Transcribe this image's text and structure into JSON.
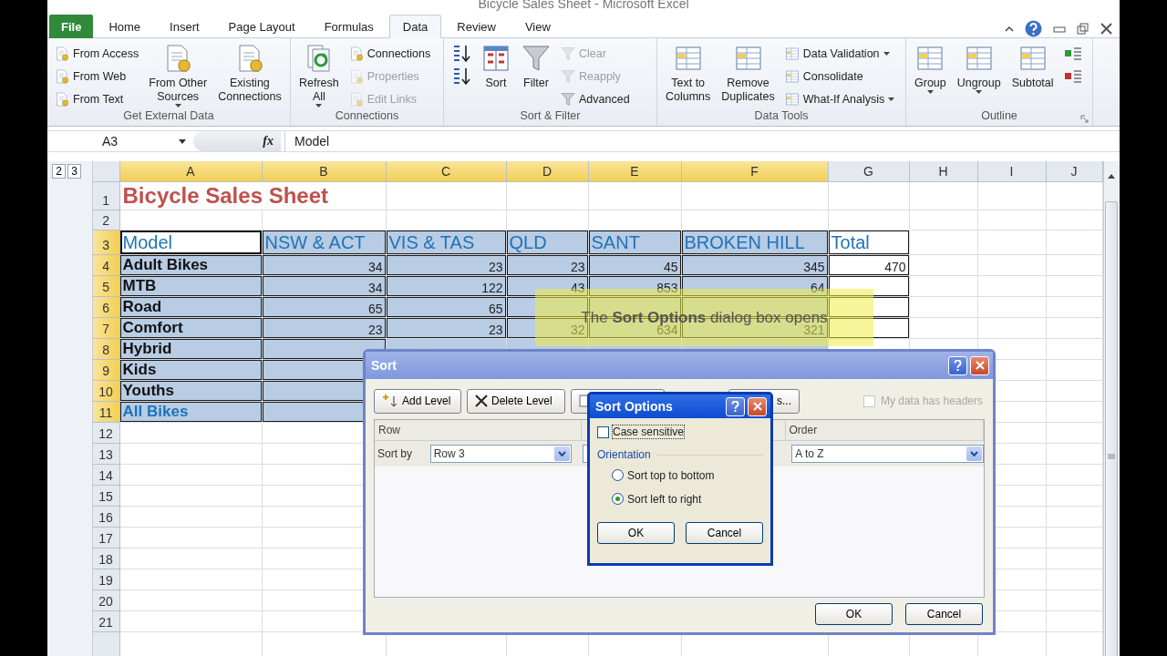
{
  "window": {
    "title": "Bicycle Sales Sheet - Microsoft Excel"
  },
  "ribbon": {
    "tabs": [
      {
        "label": "File",
        "kind": "file",
        "selected": false
      },
      {
        "label": "Home",
        "kind": "tab",
        "selected": false
      },
      {
        "label": "Insert",
        "kind": "tab",
        "selected": false
      },
      {
        "label": "Page Layout",
        "kind": "tab",
        "selected": false
      },
      {
        "label": "Formulas",
        "kind": "tab",
        "selected": false
      },
      {
        "label": "Data",
        "kind": "tab",
        "selected": true
      },
      {
        "label": "Review",
        "kind": "tab",
        "selected": false
      },
      {
        "label": "View",
        "kind": "tab",
        "selected": false
      }
    ],
    "groups": [
      {
        "title": "Get External Data",
        "launcher": false,
        "columns": [
          {
            "kind": "stack",
            "items": [
              {
                "label": "From Access",
                "disabled": false,
                "dropdown": false
              },
              {
                "label": "From Web",
                "disabled": false,
                "dropdown": false
              },
              {
                "label": "From Text",
                "disabled": false,
                "dropdown": false
              }
            ]
          },
          {
            "kind": "large",
            "label": "From Other\nSources",
            "disabled": false,
            "dropdown": true
          },
          {
            "kind": "large",
            "label": "Existing\nConnections",
            "disabled": false,
            "dropdown": false
          }
        ]
      },
      {
        "title": "Connections",
        "launcher": false,
        "columns": [
          {
            "kind": "large",
            "label": "Refresh\nAll",
            "disabled": false,
            "dropdown": true
          },
          {
            "kind": "stack",
            "items": [
              {
                "label": "Connections",
                "disabled": false,
                "dropdown": false
              },
              {
                "label": "Properties",
                "disabled": true,
                "dropdown": false
              },
              {
                "label": "Edit Links",
                "disabled": true,
                "dropdown": false
              }
            ]
          }
        ]
      },
      {
        "title": "Sort & Filter",
        "launcher": false,
        "columns": [
          {
            "kind": "stack",
            "items": [
              {
                "disabled": false,
                "dropdown": false
              },
              {
                "disabled": false,
                "dropdown": false
              }
            ]
          },
          {
            "kind": "large",
            "label": "Sort",
            "disabled": false,
            "dropdown": false
          },
          {
            "kind": "large",
            "label": "Filter",
            "disabled": false,
            "dropdown": false
          },
          {
            "kind": "stack",
            "items": [
              {
                "label": "Clear",
                "disabled": true,
                "dropdown": false
              },
              {
                "label": "Reapply",
                "disabled": true,
                "dropdown": false
              },
              {
                "label": "Advanced",
                "disabled": false,
                "dropdown": false
              }
            ]
          }
        ]
      },
      {
        "title": "Data Tools",
        "launcher": false,
        "columns": [
          {
            "kind": "large",
            "label": "Text to\nColumns",
            "disabled": false,
            "dropdown": false
          },
          {
            "kind": "large",
            "label": "Remove\nDuplicates",
            "disabled": false,
            "dropdown": false
          },
          {
            "kind": "stack",
            "items": [
              {
                "label": "Data Validation",
                "disabled": false,
                "dropdown": true
              },
              {
                "label": "Consolidate",
                "disabled": false,
                "dropdown": false
              },
              {
                "label": "What-If Analysis",
                "disabled": false,
                "dropdown": true
              }
            ]
          }
        ]
      },
      {
        "title": "Outline",
        "launcher": true,
        "columns": [
          {
            "kind": "large",
            "label": "Group",
            "disabled": false,
            "dropdown": true
          },
          {
            "kind": "large",
            "label": "Ungroup",
            "disabled": false,
            "dropdown": true
          },
          {
            "kind": "large",
            "label": "Subtotal",
            "disabled": false,
            "dropdown": false
          },
          {
            "kind": "stack",
            "items": [
              {
                "disabled": false,
                "dropdown": false
              },
              {
                "disabled": false,
                "dropdown": false
              }
            ]
          }
        ]
      }
    ]
  },
  "formula_bar": {
    "name_box": "A3",
    "fx": "fx",
    "value": "Model"
  },
  "sheet": {
    "outline_levels": [
      "2",
      "3"
    ],
    "columns": [
      {
        "label": "A",
        "selected": true
      },
      {
        "label": "B",
        "selected": true
      },
      {
        "label": "C",
        "selected": true
      },
      {
        "label": "D",
        "selected": true
      },
      {
        "label": "E",
        "selected": true
      },
      {
        "label": "F",
        "selected": true
      },
      {
        "label": "G",
        "selected": false
      },
      {
        "label": "H",
        "selected": false
      },
      {
        "label": "I",
        "selected": false
      },
      {
        "label": "J",
        "selected": false
      }
    ],
    "rows": [
      {
        "header": "1",
        "selected": false,
        "cells": [
          {
            "kind": "title",
            "text": "Bicycle Sales Sheet",
            "active": false
          }
        ]
      },
      {
        "header": "2",
        "selected": false,
        "cells": []
      },
      {
        "header": "3",
        "selected": true,
        "cells": [
          {
            "kind": "header",
            "text": "Model",
            "active": true
          },
          {
            "kind": "header",
            "text": "NSW & ACT",
            "active": false
          },
          {
            "kind": "header",
            "text": "VIS & TAS",
            "active": false
          },
          {
            "kind": "header",
            "text": "QLD",
            "active": false
          },
          {
            "kind": "header",
            "text": "SANT",
            "active": false
          },
          {
            "kind": "header",
            "text": "BROKEN HILL",
            "active": false
          },
          {
            "kind": "header",
            "text": "Total",
            "active": false
          }
        ]
      },
      {
        "header": "4",
        "selected": true,
        "cells": [
          {
            "kind": "label",
            "text": "Adult Bikes",
            "active": false
          },
          {
            "kind": "number",
            "text": "34",
            "active": false
          },
          {
            "kind": "number",
            "text": "23",
            "active": false
          },
          {
            "kind": "number",
            "text": "23",
            "active": false
          },
          {
            "kind": "number",
            "text": "45",
            "active": false
          },
          {
            "kind": "number",
            "text": "345",
            "active": false
          },
          {
            "kind": "number",
            "text": "470",
            "active": false
          }
        ]
      },
      {
        "header": "5",
        "selected": true,
        "cells": [
          {
            "kind": "label",
            "text": "MTB",
            "active": false
          },
          {
            "kind": "number",
            "text": "34",
            "active": false
          },
          {
            "kind": "number",
            "text": "122",
            "active": false
          },
          {
            "kind": "number",
            "text": "43",
            "active": false
          },
          {
            "kind": "number",
            "text": "853",
            "active": false
          },
          {
            "kind": "number",
            "text": "64",
            "active": false
          },
          {
            "kind": "blank",
            "active": false
          }
        ]
      },
      {
        "header": "6",
        "selected": true,
        "cells": [
          {
            "kind": "label",
            "text": "Road",
            "active": false
          },
          {
            "kind": "number",
            "text": "65",
            "active": false
          },
          {
            "kind": "number",
            "text": "65",
            "active": false
          },
          {
            "kind": "blank",
            "active": false
          },
          {
            "kind": "blank",
            "active": false
          },
          {
            "kind": "blank",
            "active": false
          },
          {
            "kind": "blank",
            "active": false
          }
        ]
      },
      {
        "header": "7",
        "selected": true,
        "cells": [
          {
            "kind": "label",
            "text": "Comfort",
            "active": false
          },
          {
            "kind": "number",
            "text": "23",
            "active": false
          },
          {
            "kind": "number",
            "text": "23",
            "active": false
          },
          {
            "kind": "number",
            "text": "32",
            "active": false
          },
          {
            "kind": "number",
            "text": "634",
            "active": false
          },
          {
            "kind": "number",
            "text": "321",
            "active": false
          },
          {
            "kind": "blank",
            "active": false
          }
        ]
      },
      {
        "header": "8",
        "selected": true,
        "cells": [
          {
            "kind": "label",
            "text": "Hybrid",
            "active": false
          },
          {
            "kind": "blank",
            "active": false
          }
        ]
      },
      {
        "header": "9",
        "selected": true,
        "cells": [
          {
            "kind": "label",
            "text": "Kids",
            "active": false
          },
          {
            "kind": "blank",
            "active": false
          }
        ]
      },
      {
        "header": "10",
        "selected": true,
        "cells": [
          {
            "kind": "label",
            "text": "Youths",
            "active": false
          },
          {
            "kind": "blank",
            "active": false
          }
        ]
      },
      {
        "header": "11",
        "selected": true,
        "cells": [
          {
            "kind": "total",
            "text": "All Bikes",
            "active": false
          },
          {
            "kind": "blank",
            "active": false
          }
        ]
      },
      {
        "header": "12",
        "selected": false,
        "cells": []
      },
      {
        "header": "13",
        "selected": false,
        "cells": []
      },
      {
        "header": "14",
        "selected": false,
        "cells": []
      },
      {
        "header": "15",
        "selected": false,
        "cells": []
      },
      {
        "header": "16",
        "selected": false,
        "cells": []
      },
      {
        "header": "17",
        "selected": false,
        "cells": []
      },
      {
        "header": "18",
        "selected": false,
        "cells": []
      },
      {
        "header": "19",
        "selected": false,
        "cells": []
      },
      {
        "header": "20",
        "selected": false,
        "cells": []
      },
      {
        "header": "21",
        "selected": false,
        "cells": []
      }
    ]
  },
  "callout": {
    "text": "The **Sort Options** dialog box opens"
  },
  "sort_dialog": {
    "title": "Sort",
    "toolbar": [
      {
        "kind": "add",
        "label": "Add Level"
      },
      {
        "kind": "delete",
        "label": "Delete Level"
      },
      {
        "kind": "copy"
      },
      {
        "kind": "options",
        "label": "s..."
      }
    ],
    "headers_checkbox": {
      "label": "My data has headers",
      "checked": false,
      "disabled": true
    },
    "columns": [
      {
        "label": "Row"
      },
      {},
      {
        "label": "Order"
      }
    ],
    "level": {
      "label": "Sort by",
      "sort_by": "Row 3",
      "order": "A to Z"
    },
    "buttons": [
      "OK",
      "Cancel"
    ]
  },
  "options_dialog": {
    "title": "Sort Options",
    "case_sensitive": {
      "label": "Case sensitive",
      "checked": false
    },
    "orientation": {
      "label": "Orientation",
      "options": [
        {
          "label": "Sort top to bottom",
          "selected": false
        },
        {
          "label": "Sort left to right",
          "selected": true
        }
      ]
    },
    "buttons": [
      "OK",
      "Cancel"
    ]
  }
}
